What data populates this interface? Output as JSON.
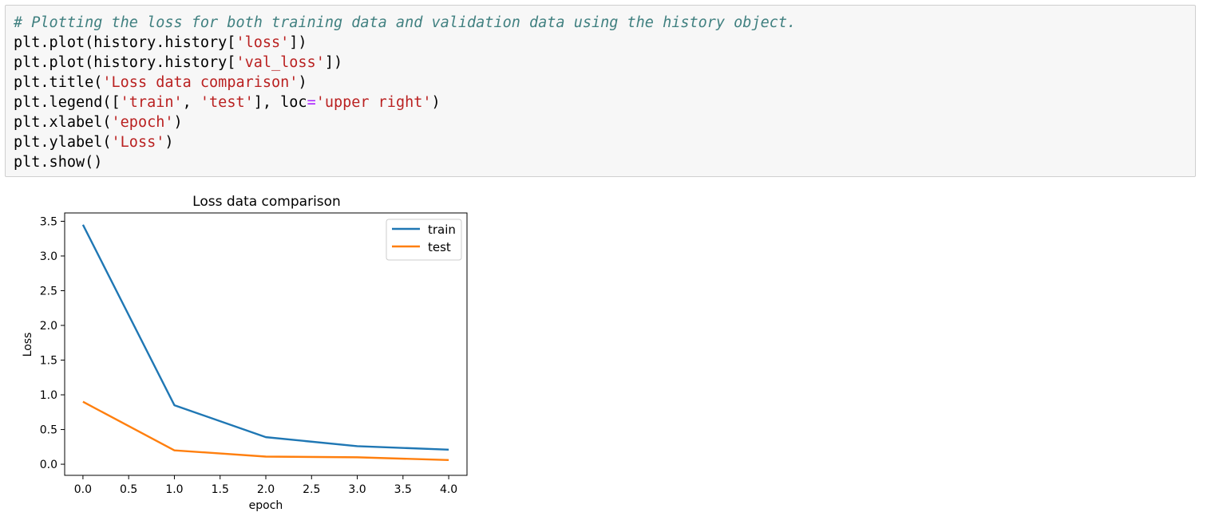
{
  "code_cell": {
    "lines": [
      [
        {
          "t": "# Plotting the loss for both training data and validation data using the history object.",
          "k": "comment"
        }
      ],
      [
        {
          "t": "plt.plot(history.history[",
          "k": "n"
        },
        {
          "t": "'loss'",
          "k": "str"
        },
        {
          "t": "])",
          "k": "n"
        }
      ],
      [
        {
          "t": "plt.plot(history.history[",
          "k": "n"
        },
        {
          "t": "'val_loss'",
          "k": "str"
        },
        {
          "t": "])",
          "k": "n"
        }
      ],
      [
        {
          "t": "plt.title(",
          "k": "n"
        },
        {
          "t": "'Loss data comparison'",
          "k": "str"
        },
        {
          "t": ")",
          "k": "n"
        }
      ],
      [
        {
          "t": "plt.legend([",
          "k": "n"
        },
        {
          "t": "'train'",
          "k": "str"
        },
        {
          "t": ", ",
          "k": "n"
        },
        {
          "t": "'test'",
          "k": "str"
        },
        {
          "t": "], loc",
          "k": "n"
        },
        {
          "t": "=",
          "k": "op"
        },
        {
          "t": "'upper right'",
          "k": "str"
        },
        {
          "t": ")",
          "k": "n"
        }
      ],
      [
        {
          "t": "plt.xlabel(",
          "k": "n"
        },
        {
          "t": "'epoch'",
          "k": "str"
        },
        {
          "t": ")",
          "k": "n"
        }
      ],
      [
        {
          "t": "plt.ylabel(",
          "k": "n"
        },
        {
          "t": "'Loss'",
          "k": "str"
        },
        {
          "t": ")",
          "k": "n"
        }
      ],
      [
        {
          "t": "plt.show()",
          "k": "n"
        }
      ]
    ]
  },
  "chart_data": {
    "type": "line",
    "title": "Loss data comparison",
    "xlabel": "epoch",
    "ylabel": "Loss",
    "x": [
      0,
      1,
      2,
      3,
      4
    ],
    "xlim": [
      -0.2,
      4.2
    ],
    "ylim": [
      -0.16,
      3.62
    ],
    "xticks": [
      0.0,
      0.5,
      1.0,
      1.5,
      2.0,
      2.5,
      3.0,
      3.5,
      4.0
    ],
    "xtick_labels": [
      "0.0",
      "0.5",
      "1.0",
      "1.5",
      "2.0",
      "2.5",
      "3.0",
      "3.5",
      "4.0"
    ],
    "yticks": [
      0.0,
      0.5,
      1.0,
      1.5,
      2.0,
      2.5,
      3.0,
      3.5
    ],
    "ytick_labels": [
      "0.0",
      "0.5",
      "1.0",
      "1.5",
      "2.0",
      "2.5",
      "3.0",
      "3.5"
    ],
    "grid": false,
    "legend_position": "upper right",
    "series": [
      {
        "name": "train",
        "color": "#1f77b4",
        "values": [
          3.45,
          0.85,
          0.39,
          0.26,
          0.21
        ]
      },
      {
        "name": "test",
        "color": "#ff7f0e",
        "values": [
          0.9,
          0.2,
          0.11,
          0.1,
          0.06
        ]
      }
    ]
  }
}
